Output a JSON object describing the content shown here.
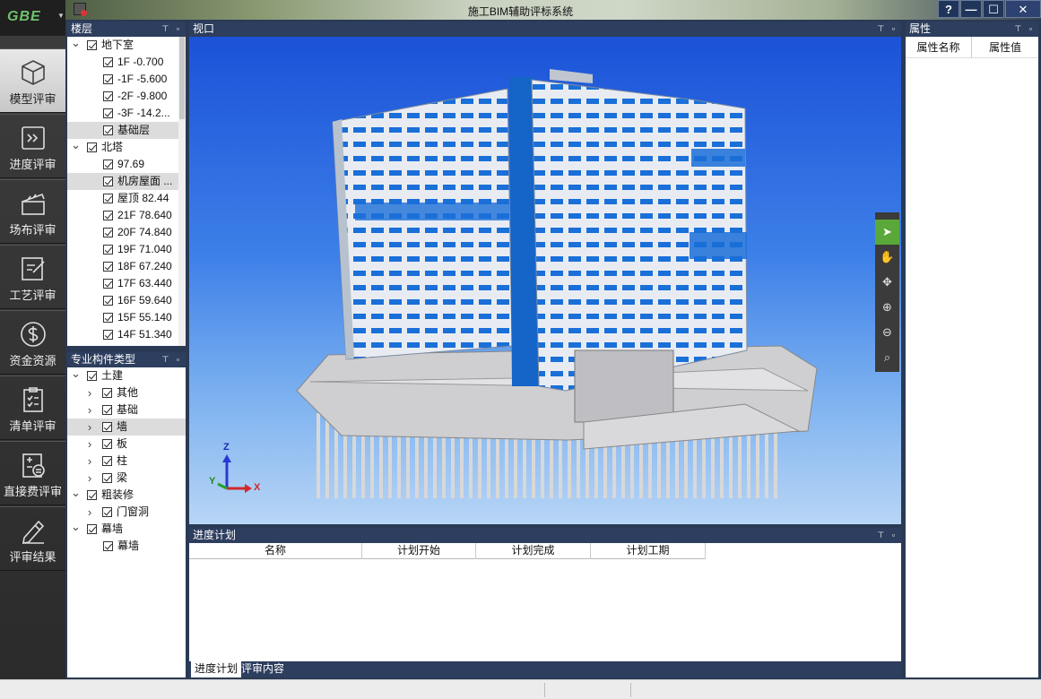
{
  "app": {
    "title": "施工BIM辅助评标系统",
    "logo": "GBE"
  },
  "window_controls": [
    "?",
    "—",
    "☐",
    "✕"
  ],
  "nav": [
    {
      "label": "模型评审",
      "icon": "cube-icon",
      "active": true
    },
    {
      "label": "进度评审",
      "icon": "progress-icon",
      "active": false
    },
    {
      "label": "场布评审",
      "icon": "clapper-icon",
      "active": false
    },
    {
      "label": "工艺评审",
      "icon": "edit-doc-icon",
      "active": false
    },
    {
      "label": "资金资源",
      "icon": "dollar-icon",
      "active": false
    },
    {
      "label": "清单评审",
      "icon": "checklist-icon",
      "active": false
    },
    {
      "label": "直接费评审",
      "icon": "calc-doc-icon",
      "active": false
    },
    {
      "label": "评审结果",
      "icon": "pen-icon",
      "active": false
    }
  ],
  "floors_panel": {
    "title": "楼层",
    "rows": [
      {
        "label": "地下室",
        "level": 0,
        "caret": "v"
      },
      {
        "label": "1F -0.700",
        "level": 1
      },
      {
        "label": "-1F  -5.600",
        "level": 1
      },
      {
        "label": "-2F -9.800",
        "level": 1
      },
      {
        "label": "-3F  -14.2...",
        "level": 1
      },
      {
        "label": "基础层",
        "level": 1,
        "selected": true
      },
      {
        "label": "北塔",
        "level": 0,
        "caret": "v"
      },
      {
        "label": "97.69",
        "level": 1
      },
      {
        "label": "机房屋面 ...",
        "level": 1,
        "selected": true
      },
      {
        "label": "屋顶  82.44",
        "level": 1
      },
      {
        "label": "21F 78.640",
        "level": 1
      },
      {
        "label": "20F 74.840",
        "level": 1
      },
      {
        "label": "19F 71.040",
        "level": 1
      },
      {
        "label": "18F 67.240",
        "level": 1
      },
      {
        "label": "17F 63.440",
        "level": 1
      },
      {
        "label": "16F 59.640",
        "level": 1
      },
      {
        "label": "15F 55.140",
        "level": 1
      },
      {
        "label": "14F 51.340",
        "level": 1
      }
    ]
  },
  "types_panel": {
    "title": "专业构件类型",
    "rows": [
      {
        "label": "土建",
        "level": 0,
        "caret": "v"
      },
      {
        "label": "其他",
        "level": 1,
        "caret": ">"
      },
      {
        "label": "基础",
        "level": 1,
        "caret": ">"
      },
      {
        "label": "墙",
        "level": 1,
        "caret": ">",
        "selected": true
      },
      {
        "label": "板",
        "level": 1,
        "caret": ">"
      },
      {
        "label": "柱",
        "level": 1,
        "caret": ">"
      },
      {
        "label": "梁",
        "level": 1,
        "caret": ">"
      },
      {
        "label": "粗装修",
        "level": 0,
        "caret": "v"
      },
      {
        "label": "门窗洞",
        "level": 1,
        "caret": ">"
      },
      {
        "label": "幕墙",
        "level": 0,
        "caret": "v"
      },
      {
        "label": "幕墙",
        "level": 1
      }
    ]
  },
  "viewport": {
    "title": "视口",
    "axes": {
      "x": "X",
      "y": "Y",
      "z": "Z"
    }
  },
  "schedule_panel": {
    "title": "进度计划",
    "columns": [
      "名称",
      "计划开始",
      "计划完成",
      "计划工期"
    ],
    "tabs": [
      "进度计划",
      "评审内容"
    ]
  },
  "properties_panel": {
    "title": "属性",
    "columns": [
      "属性名称",
      "属性值"
    ]
  },
  "view_tools": [
    "select-icon",
    "pan-hand-icon",
    "orbit-icon",
    "zoom-in-icon",
    "zoom-out-icon",
    "zoom-fit-icon"
  ],
  "colors": {
    "panel_header": "#2d3e5e",
    "accent_green": "#5aa83a"
  }
}
